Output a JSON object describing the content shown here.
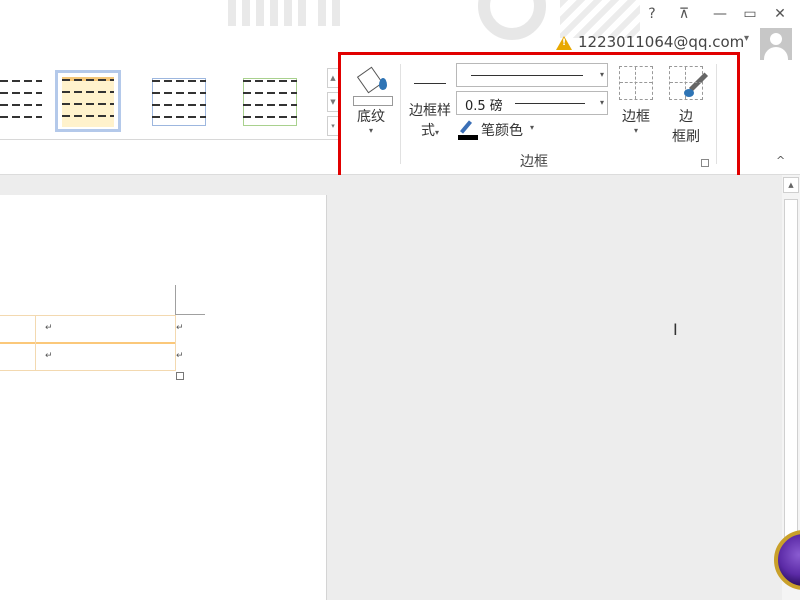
{
  "window": {
    "help_label": "?",
    "ribbon_display_label": "⊼",
    "minimize_label": "—",
    "restore_label": "▭",
    "close_label": "✕"
  },
  "account": {
    "warning_icon": "warning-icon",
    "email": "1223011064@qq.com",
    "caret": "▾"
  },
  "ribbon": {
    "table_styles_gallery": {
      "tiles": [
        "plain-table-style",
        "grid-table-style-orange",
        "grid-table-style-blue",
        "grid-table-style-green"
      ],
      "selected_index": 1
    },
    "borders_group": {
      "shading_label": "底纹",
      "border_styles_label_1": "边框样",
      "border_styles_label_2": "式",
      "line_style_value": "",
      "line_weight_value": "0.5 磅",
      "pen_color_label": "笔颜色",
      "borders_label": "边框",
      "border_painter_label_1": "边",
      "border_painter_label_2": "框刷",
      "group_label": "边框",
      "caret": "▾"
    },
    "collapse_label": "^",
    "highlight_color": "#e10000"
  },
  "document": {
    "table_cells": [
      "↵",
      "↵",
      "↵",
      "↵"
    ],
    "table_accent_color": "#fbc87a"
  },
  "colors": {
    "pen_color": "#000000",
    "shading_accent": "#2e74b5"
  }
}
